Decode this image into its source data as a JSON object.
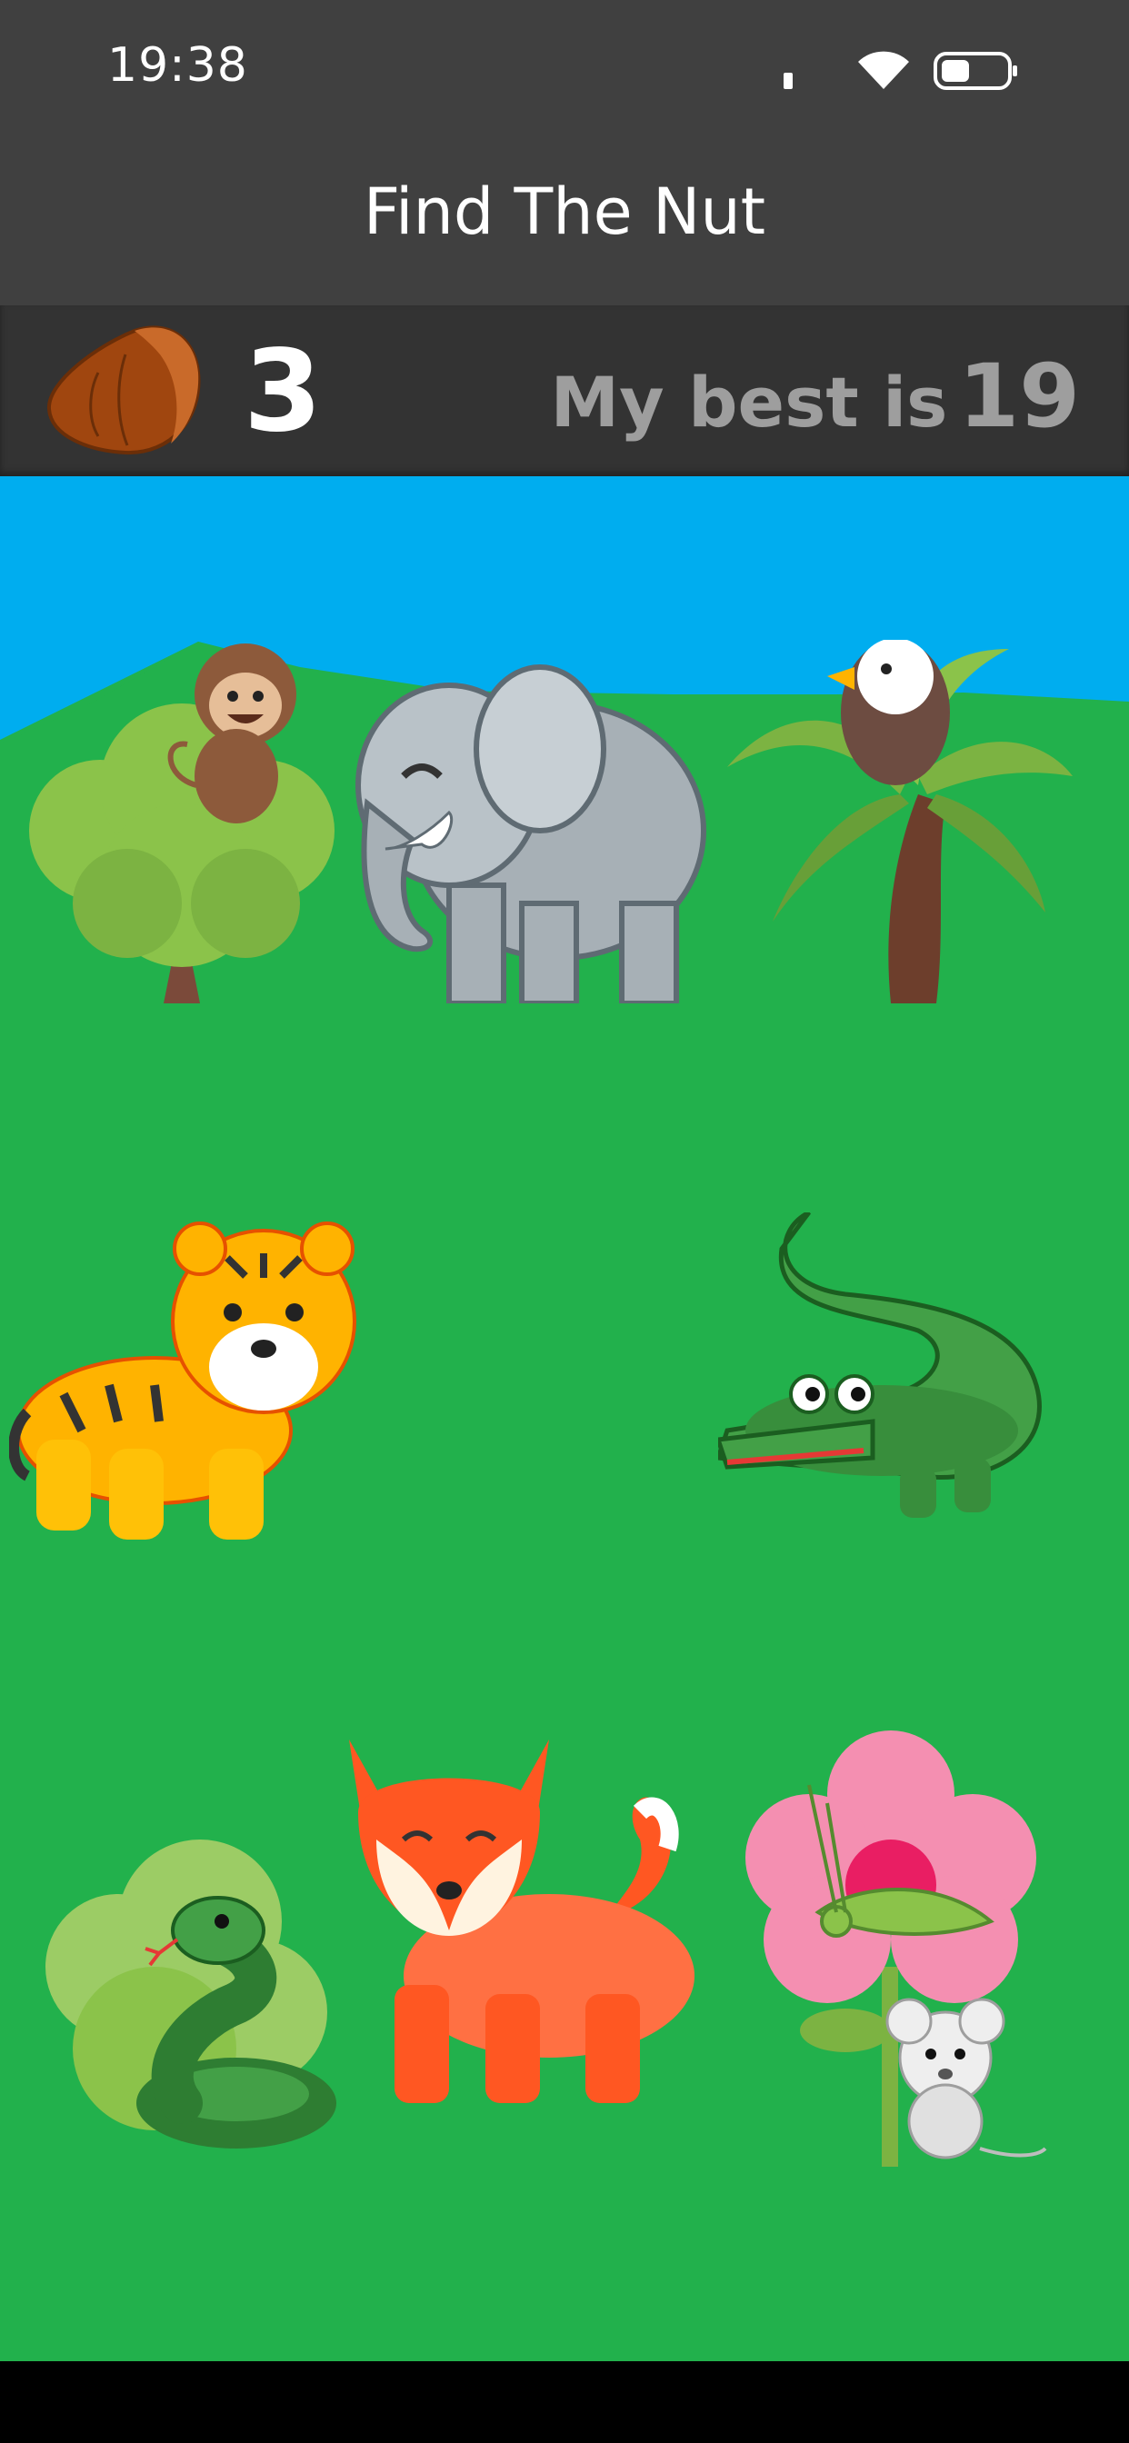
{
  "status_bar": {
    "time": "19:38",
    "icons": [
      "signal-dot-icon",
      "wifi-icon",
      "battery-icon"
    ]
  },
  "app_bar": {
    "title": "Find The Nut"
  },
  "score_bar": {
    "icon": "nut-icon",
    "score": "3",
    "best_label": "My best is",
    "best_value": "19"
  },
  "playfield": {
    "colors": {
      "sky": "#00ADEF",
      "grass": "#22B14C"
    },
    "grid": [
      [
        "monkey-in-tree",
        "elephant",
        "eagle-on-palm"
      ],
      [
        "tiger",
        "",
        "crocodile"
      ],
      [
        "snake-in-bush",
        "fox",
        "grasshopper-on-flower-and-mouse"
      ]
    ]
  }
}
